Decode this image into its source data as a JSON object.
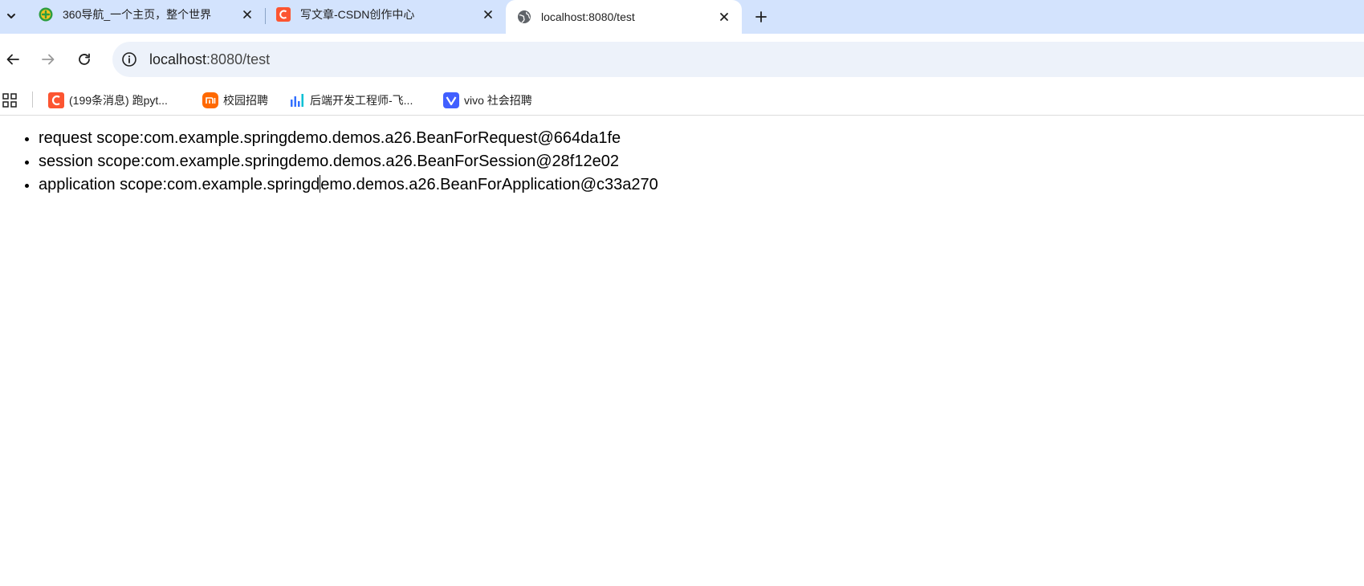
{
  "browser": {
    "tabs": [
      {
        "title": "360导航_一个主页，整个世界",
        "favicon": "360-icon",
        "active": false
      },
      {
        "title": "写文章-CSDN创作中心",
        "favicon": "csdn-icon",
        "active": false
      },
      {
        "title": "localhost:8080/test",
        "favicon": "globe-icon",
        "active": true
      }
    ],
    "address": {
      "host": "localhost",
      "rest": ":8080/test"
    },
    "bookmarks": [
      {
        "label": "(199条消息) 跑pyt...",
        "icon": "csdn-icon"
      },
      {
        "label": "校园招聘",
        "icon": "mi-icon"
      },
      {
        "label": "后端开发工程师-飞...",
        "icon": "chart-bars-icon"
      },
      {
        "label": "vivo 社会招聘",
        "icon": "vivo-icon"
      }
    ]
  },
  "page": {
    "items": [
      "request scope:com.example.springdemo.demos.a26.BeanForRequest@664da1fe",
      "session scope:com.example.springdemo.demos.a26.BeanForSession@28f12e02",
      {
        "before": "application scope:com.example.springd",
        "after": "emo.demos.a26.BeanForApplication@c33a270"
      }
    ]
  },
  "colors": {
    "tabstrip": "#d3e3fd",
    "omnibox": "#edf2fa",
    "csdn": "#fc5531",
    "vivo": "#415fff",
    "mi": "#ff6900"
  }
}
